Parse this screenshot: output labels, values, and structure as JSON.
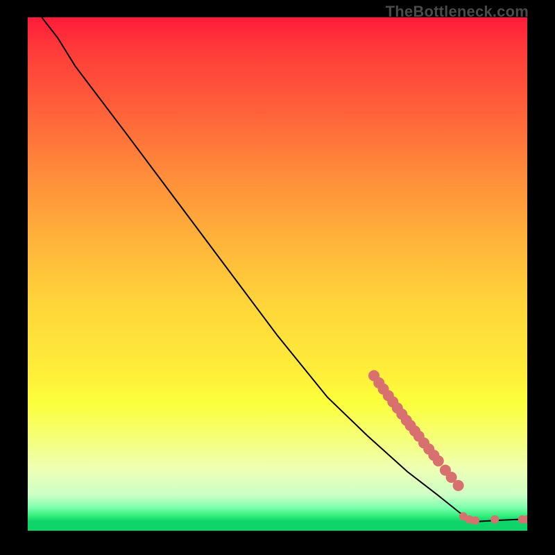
{
  "watermark": "TheBottleneck.com",
  "chart_data": {
    "type": "line",
    "title": "",
    "xlabel": "",
    "ylabel": "",
    "x_range": [
      0,
      1
    ],
    "y_range": [
      0,
      1
    ],
    "curve": [
      {
        "x": 0.028,
        "y": 1.0
      },
      {
        "x": 0.06,
        "y": 0.96
      },
      {
        "x": 0.095,
        "y": 0.905
      },
      {
        "x": 0.13,
        "y": 0.86
      },
      {
        "x": 0.2,
        "y": 0.77
      },
      {
        "x": 0.3,
        "y": 0.64
      },
      {
        "x": 0.4,
        "y": 0.51
      },
      {
        "x": 0.5,
        "y": 0.38
      },
      {
        "x": 0.6,
        "y": 0.26
      },
      {
        "x": 0.68,
        "y": 0.185
      },
      {
        "x": 0.76,
        "y": 0.115
      },
      {
        "x": 0.82,
        "y": 0.07
      },
      {
        "x": 0.865,
        "y": 0.035
      },
      {
        "x": 0.885,
        "y": 0.022
      },
      {
        "x": 0.9,
        "y": 0.018
      },
      {
        "x": 0.935,
        "y": 0.02
      },
      {
        "x": 0.98,
        "y": 0.022
      },
      {
        "x": 1.0,
        "y": 0.022
      }
    ],
    "cluster_segment": [
      {
        "x": 0.693,
        "y": 0.302
      },
      {
        "x": 0.703,
        "y": 0.288
      },
      {
        "x": 0.712,
        "y": 0.276
      },
      {
        "x": 0.722,
        "y": 0.263
      },
      {
        "x": 0.731,
        "y": 0.251
      },
      {
        "x": 0.74,
        "y": 0.239
      },
      {
        "x": 0.749,
        "y": 0.227
      },
      {
        "x": 0.758,
        "y": 0.215
      },
      {
        "x": 0.766,
        "y": 0.205
      },
      {
        "x": 0.775,
        "y": 0.194
      },
      {
        "x": 0.783,
        "y": 0.184
      },
      {
        "x": 0.793,
        "y": 0.171
      },
      {
        "x": 0.803,
        "y": 0.159
      },
      {
        "x": 0.813,
        "y": 0.147
      },
      {
        "x": 0.822,
        "y": 0.136
      },
      {
        "x": 0.836,
        "y": 0.118
      },
      {
        "x": 0.848,
        "y": 0.104
      },
      {
        "x": 0.862,
        "y": 0.088
      }
    ],
    "near_bottom_points": [
      {
        "x": 0.872,
        "y": 0.028
      },
      {
        "x": 0.884,
        "y": 0.022
      },
      {
        "x": 0.896,
        "y": 0.02
      },
      {
        "x": 0.935,
        "y": 0.022
      },
      {
        "x": 0.99,
        "y": 0.022
      },
      {
        "x": 1.0,
        "y": 0.022
      }
    ],
    "colors": {
      "curve": "#000000",
      "points": "#d87070",
      "gradient_top": "#ff1a3a",
      "gradient_bottom": "#0fd468",
      "frame": "#000000"
    }
  }
}
